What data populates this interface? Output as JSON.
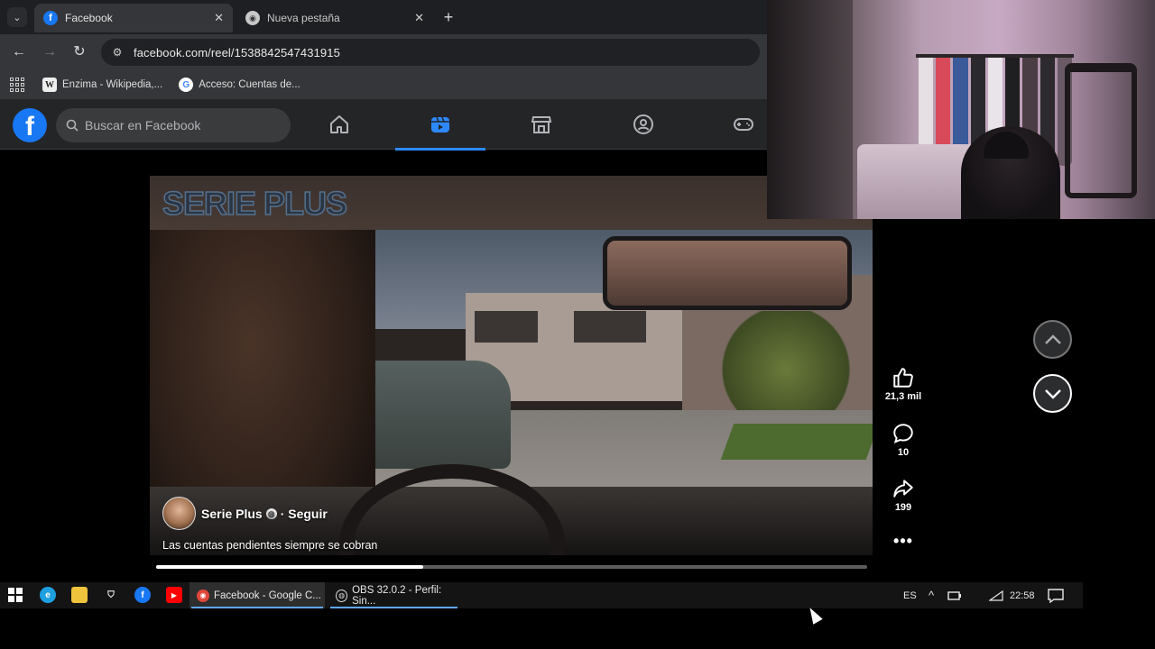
{
  "browser": {
    "tabs": [
      {
        "title": "Facebook",
        "active": true,
        "favicon": "facebook-icon"
      },
      {
        "title": "Nueva pestaña",
        "active": false,
        "favicon": "chrome-icon"
      }
    ],
    "url": "facebook.com/reel/1538842547431915",
    "bookmarks": [
      {
        "label": "Enzima - Wikipedia,...",
        "icon": "wikipedia-icon"
      },
      {
        "label": "Acceso: Cuentas de...",
        "icon": "google-icon"
      }
    ]
  },
  "facebook": {
    "search_placeholder": "Buscar en Facebook",
    "brand_color": "#1877f2",
    "nav": [
      {
        "name": "home",
        "active": false
      },
      {
        "name": "reels",
        "active": true
      },
      {
        "name": "marketplace",
        "active": false
      },
      {
        "name": "groups",
        "active": false
      },
      {
        "name": "gaming",
        "active": false
      }
    ]
  },
  "reel": {
    "watermark": "SERIE PLUS",
    "owner": "Serie Plus",
    "follow": "· Seguir",
    "caption": "Las cuentas pendientes siempre se cobran",
    "progress": 0.375,
    "actions": {
      "likes": "21,3 mil",
      "comments": "10",
      "shares": "199"
    }
  },
  "taskbar": {
    "tasks": [
      {
        "label": "Facebook - Google C...",
        "active": true
      },
      {
        "label": "OBS 32.0.2 - Perfil: Sin...",
        "active": false
      }
    ],
    "language": "ES",
    "time": "22:58"
  }
}
